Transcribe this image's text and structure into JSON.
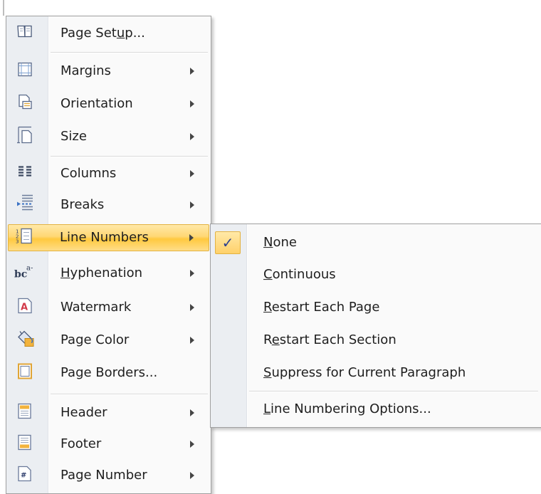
{
  "main_menu": {
    "items": [
      {
        "label": "Page Setup...",
        "icon": "page-setup-icon",
        "submenu": false
      },
      {
        "label": "Margins",
        "icon": "margins-icon",
        "submenu": true
      },
      {
        "label": "Orientation",
        "icon": "orientation-icon",
        "submenu": true
      },
      {
        "label": "Size",
        "icon": "size-icon",
        "submenu": true
      },
      {
        "label": "Columns",
        "icon": "columns-icon",
        "submenu": true
      },
      {
        "label": "Breaks",
        "icon": "breaks-icon",
        "submenu": true
      },
      {
        "label": "Line Numbers",
        "icon": "line-numbers-icon",
        "submenu": true,
        "highlighted": true
      },
      {
        "label": "Hyphenation",
        "icon": "hyphenation-icon",
        "submenu": true,
        "icon_text": "a-b c"
      },
      {
        "label": "Watermark",
        "icon": "watermark-icon",
        "submenu": true
      },
      {
        "label": "Page Color",
        "icon": "page-color-icon",
        "submenu": true
      },
      {
        "label": "Page Borders...",
        "icon": "page-borders-icon",
        "submenu": false
      },
      {
        "label": "Header",
        "icon": "header-icon",
        "submenu": true
      },
      {
        "label": "Footer",
        "icon": "footer-icon",
        "submenu": true
      },
      {
        "label": "Page Number",
        "icon": "page-number-icon",
        "submenu": true
      }
    ]
  },
  "line_numbers_submenu": {
    "items": [
      {
        "label": "None",
        "checked": true
      },
      {
        "label": "Continuous",
        "checked": false
      },
      {
        "label": "Restart Each Page",
        "checked": false
      },
      {
        "label": "Restart Each Section",
        "checked": false
      },
      {
        "label": "Suppress for Current Paragraph",
        "checked": false
      },
      {
        "label": "Line Numbering Options...",
        "checked": false
      }
    ],
    "check_glyph": "✓"
  },
  "colors": {
    "highlight": "#ffd774",
    "check": "#2b3f8f"
  }
}
